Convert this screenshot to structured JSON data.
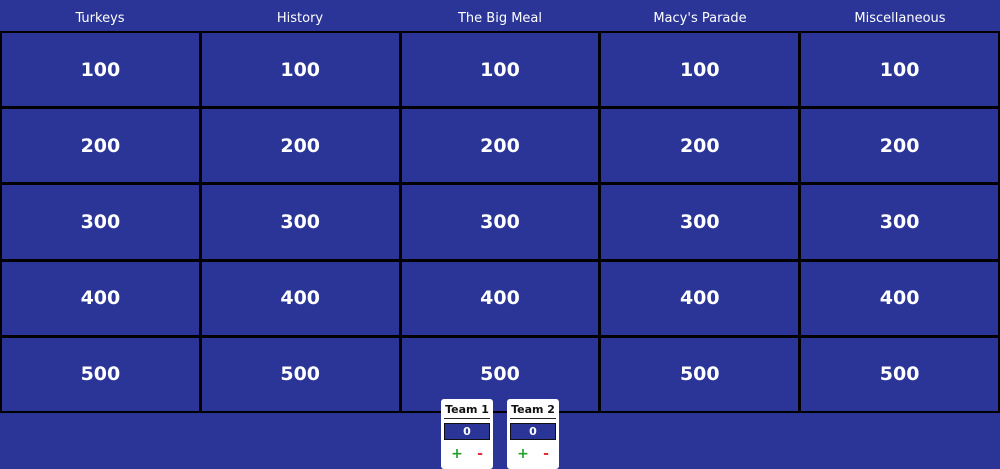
{
  "categories": [
    "Turkeys",
    "History",
    "The Big Meal",
    "Macy's Parade",
    "Miscellaneous"
  ],
  "board": {
    "rows": [
      [
        "100",
        "100",
        "100",
        "100",
        "100"
      ],
      [
        "200",
        "200",
        "200",
        "200",
        "200"
      ],
      [
        "300",
        "300",
        "300",
        "300",
        "300"
      ],
      [
        "400",
        "400",
        "400",
        "400",
        "400"
      ],
      [
        "500",
        "500",
        "500",
        "500",
        "500"
      ]
    ]
  },
  "teams": [
    {
      "name": "Team 1",
      "score": "0",
      "plus": "+",
      "minus": "-"
    },
    {
      "name": "Team 2",
      "score": "0",
      "plus": "+",
      "minus": "-"
    }
  ],
  "colors": {
    "board_bg": "#2a3597",
    "grid_lines": "#000000",
    "text": "#ffffff",
    "plus": "#22a02c",
    "minus": "#e23030"
  }
}
